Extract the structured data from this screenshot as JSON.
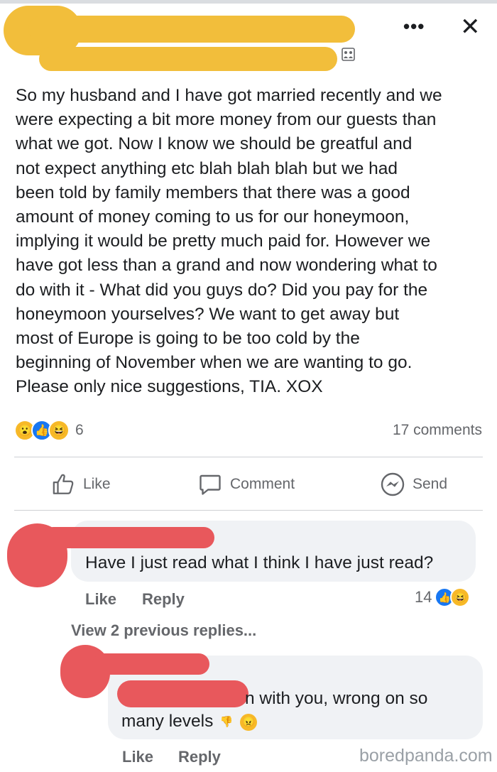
{
  "header": {
    "more_label": "•••",
    "close_label": "✕",
    "group_icon": "group-photo-icon",
    "redaction_color": "#f2be3b"
  },
  "post": {
    "lines": [
      "So my husband and I have got married recently and we",
      "were expecting a bit more money from our guests than",
      "what we got. Now I know we should be greatful and",
      "not expect anything etc blah blah blah but we had",
      "been told by family members that there was a good",
      "amount of money coming to us for our honeymoon,",
      "implying it would be pretty much paid for. However we",
      "have got less than a grand and now wondering what to",
      "do with it - What did you guys do? Did you pay for the",
      "honeymoon yourselves? We want to get away but",
      "most of Europe is going to be too cold by the",
      "beginning of November when we are wanting to go.",
      "Please only nice suggestions, TIA. XOX"
    ]
  },
  "reactions": {
    "icons": [
      "wow-icon",
      "like-icon",
      "haha-icon"
    ],
    "count": "6",
    "comments": "17 comments"
  },
  "actions": {
    "like": "Like",
    "comment": "Comment",
    "send": "Send"
  },
  "comments": [
    {
      "text": "Have I just read what I think I have just read?",
      "like": "Like",
      "reply": "Reply",
      "reaction_count": "14",
      "redaction_color": "#e8585c"
    }
  ],
  "view_previous": "View 2 previous replies...",
  "reply": {
    "text_line1": "n with you, wrong on so",
    "text_line2": "many levels",
    "like": "Like",
    "reply": "Reply"
  },
  "watermark": "boredpanda.com",
  "colors": {
    "facebook_blue": "#1877f2",
    "meta_gray": "#65676b",
    "bubble": "#f0f2f5"
  }
}
